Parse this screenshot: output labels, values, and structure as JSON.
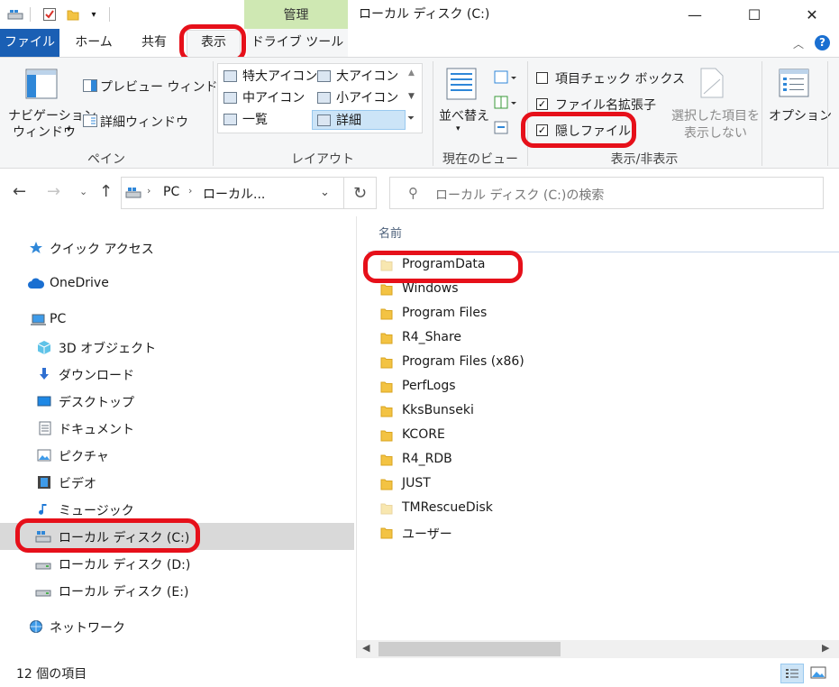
{
  "titlebar": {
    "manage_tab": "管理",
    "window_title": "ローカル ディスク (C:)",
    "minimize_glyph": "—",
    "maximize_glyph": "☐",
    "close_glyph": "✕"
  },
  "ribbon_tabs": {
    "file": "ファイル",
    "home": "ホーム",
    "share": "共有",
    "view": "表示",
    "drive_tools": "ドライブ ツール"
  },
  "ribbon": {
    "pane_group": {
      "nav_pane_line1": "ナビゲーション",
      "nav_pane_line2": "ウィンドウ",
      "preview_pane": "プレビュー ウィンドウ",
      "details_pane": "詳細ウィンドウ",
      "label": "ペイン"
    },
    "layout_group": {
      "items": [
        "特大アイコン",
        "大アイコン",
        "中アイコン",
        "小アイコン",
        "一覧",
        "詳細"
      ],
      "selected": "詳細",
      "label": "レイアウト"
    },
    "current_view_group": {
      "sort_by": "並べ替え",
      "label": "現在のビュー"
    },
    "show_hide_group": {
      "item_checkboxes": "項目チェック ボックス",
      "item_checkboxes_checked": false,
      "file_name_extensions": "ファイル名拡張子",
      "file_name_extensions_checked": true,
      "hidden_items": "隠しファイル",
      "hidden_items_checked": true,
      "hide_selected_line1": "選択した項目を",
      "hide_selected_line2": "表示しない",
      "label": "表示/非表示"
    },
    "options": "オプション"
  },
  "address": {
    "path_pc": "PC",
    "path_drive": "ローカル...",
    "search_placeholder": "ローカル ディスク (C:)の検索"
  },
  "nav_pane": {
    "items": [
      {
        "label": "クイック アクセス",
        "icon": "star-icon"
      },
      {
        "label": "OneDrive",
        "icon": "cloud-icon"
      },
      {
        "label": "PC",
        "icon": "pc-icon"
      },
      {
        "label": "3D オブジェクト",
        "icon": "cube-icon"
      },
      {
        "label": "ダウンロード",
        "icon": "download-icon"
      },
      {
        "label": "デスクトップ",
        "icon": "desktop-icon"
      },
      {
        "label": "ドキュメント",
        "icon": "document-icon"
      },
      {
        "label": "ピクチャ",
        "icon": "picture-icon"
      },
      {
        "label": "ビデオ",
        "icon": "video-icon"
      },
      {
        "label": "ミュージック",
        "icon": "music-icon"
      },
      {
        "label": "ローカル ディスク (C:)",
        "icon": "windows-drive-icon"
      },
      {
        "label": "ローカル ディスク (D:)",
        "icon": "drive-icon"
      },
      {
        "label": "ローカル ディスク (E:)",
        "icon": "drive-icon"
      },
      {
        "label": "ネットワーク",
        "icon": "network-icon"
      }
    ],
    "selected": "ローカル ディスク (C:)"
  },
  "file_list": {
    "column_name": "名前",
    "items": [
      {
        "name": "ProgramData",
        "hidden": true
      },
      {
        "name": "Windows",
        "hidden": false
      },
      {
        "name": "Program Files",
        "hidden": false
      },
      {
        "name": "R4_Share",
        "hidden": false
      },
      {
        "name": "Program Files (x86)",
        "hidden": false
      },
      {
        "name": "PerfLogs",
        "hidden": false
      },
      {
        "name": "KksBunseki",
        "hidden": false
      },
      {
        "name": "KCORE",
        "hidden": false
      },
      {
        "name": "R4_RDB",
        "hidden": false
      },
      {
        "name": "JUST",
        "hidden": false
      },
      {
        "name": "TMRescueDisk",
        "hidden": true
      },
      {
        "name": "ユーザー",
        "hidden": false
      }
    ]
  },
  "status_bar": {
    "item_count": "12 個の項目"
  },
  "colors": {
    "accent_blue": "#1a5fb4",
    "manage_green": "#cfe8b3",
    "highlight_red": "#e6101a",
    "folder_yellow": "#f3c343",
    "selected_gray": "#d9d9d9"
  }
}
